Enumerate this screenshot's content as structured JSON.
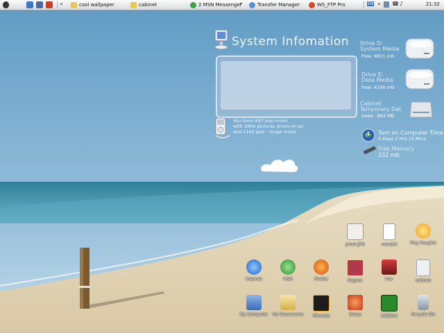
{
  "taskbar": {
    "tasks": [
      {
        "label": "cool wallpaper",
        "icon": "folder-icon"
      },
      {
        "label": "cabinet",
        "icon": "folder-icon"
      },
      {
        "label": "2 MSN Messenger",
        "icon": "msn-icon"
      },
      {
        "label": "Transfer Manager",
        "icon": "transfer-icon"
      },
      {
        "label": "WS_FTP Pro",
        "icon": "ftp-icon"
      }
    ],
    "language": "EN",
    "clock": "21:32"
  },
  "widgets": {
    "system_info_title": "System Infomation",
    "music_lines": [
      "You have 897 pop music",
      "with 1806 pictures strore on pc",
      "and 1162 Jazz - louge music"
    ],
    "drives": [
      {
        "name_lines": [
          "Drive D:",
          "System Media"
        ],
        "status": "Free: 8911 mb"
      },
      {
        "name_lines": [
          "Drive E:",
          "Data Media"
        ],
        "status": "Free: 4190 mb"
      },
      {
        "name_lines": [
          "Cabinet",
          "Temporary Dat."
        ],
        "status": "Used : 863 MB."
      }
    ],
    "uptime": {
      "label": "Turn on Computer Time",
      "value": "0 Days  2 Hrs 15 Mins"
    },
    "memory": {
      "label": "Free Memory",
      "value": "232 mb"
    }
  },
  "desktop_icons": [
    {
      "label": "prom.JPG",
      "icon": "jpg-file-icon"
    },
    {
      "label": "nonokit",
      "icon": "text-file-icon"
    },
    {
      "label": "Play PangYa!",
      "icon": "pangya-icon"
    },
    {
      "label": "Internet",
      "icon": "internet-explorer-icon"
    },
    {
      "label": "MSN",
      "icon": "msn-icon"
    },
    {
      "label": "Firefox",
      "icon": "firefox-icon"
    },
    {
      "label": "Ragnar",
      "icon": "ragnarok-icon"
    },
    {
      "label": "trar",
      "icon": "app-icon"
    },
    {
      "label": "cabinet",
      "icon": "drive-icon"
    },
    {
      "label": "My Computer",
      "icon": "my-computer-icon"
    },
    {
      "label": "My Documents",
      "icon": "my-documents-icon"
    },
    {
      "label": "Winamp",
      "icon": "winamp-icon"
    },
    {
      "label": "Setup",
      "icon": "setup-icon"
    },
    {
      "label": "ACDSee",
      "icon": "acdsee-icon"
    },
    {
      "label": "Recycle Bin",
      "icon": "recycle-bin-icon"
    }
  ]
}
